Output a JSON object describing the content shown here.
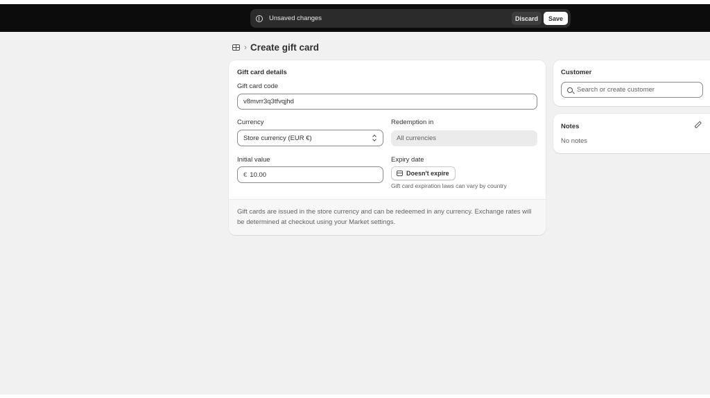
{
  "save_bar": {
    "message": "Unsaved changes",
    "discard_label": "Discard",
    "save_label": "Save"
  },
  "breadcrumb": {
    "icon": "gift-card-icon",
    "title": "Create gift card"
  },
  "gift_card_details": {
    "heading": "Gift card details",
    "code_label": "Gift card code",
    "code_value": "v8mvrr3q3tfvqjhd",
    "currency_label": "Currency",
    "currency_value": "Store currency (EUR €)",
    "redemption_label": "Redemption in",
    "redemption_value": "All currencies",
    "initial_value_label": "Initial value",
    "initial_value_prefix": "€",
    "initial_value": "10.00",
    "expiry_label": "Expiry date",
    "expiry_button": "Doesn't expire",
    "expiry_help": "Gift card expiration laws can vary by country",
    "footer_text": "Gift cards are issued in the store currency and can be redeemed in any currency. Exchange rates will be determined at checkout using your Market settings."
  },
  "customer": {
    "heading": "Customer",
    "search_placeholder": "Search or create customer"
  },
  "notes": {
    "heading": "Notes",
    "value": "No notes"
  }
}
